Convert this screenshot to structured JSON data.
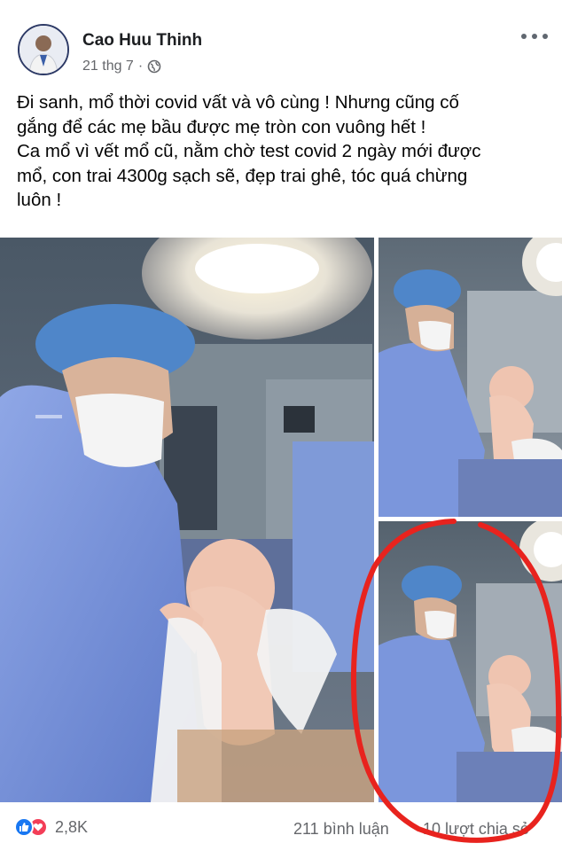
{
  "post": {
    "author": "Cao Huu Thinh",
    "date": "21 thg 7",
    "separator": "·",
    "privacy_icon": "globe-icon",
    "menu_icon": "more-horizontal-icon",
    "text_lines": [
      "Đi sanh, mổ thời covid vất và vô cùng ! Nhưng cũng cố",
      "gắng để các mẹ bầu được mẹ tròn con vuông hết !",
      "Ca mổ vì vết mổ cũ, nằm chờ test covid 2 ngày mới được",
      "mổ, con trai 4300g sạch sẽ, đẹp trai ghê, tóc quá chừng",
      "luôn !"
    ]
  },
  "photos": [
    {
      "description_icon": "operating-room-photo"
    },
    {
      "description_icon": "operating-room-photo"
    },
    {
      "description_icon": "operating-room-photo"
    }
  ],
  "footer": {
    "reaction_icons": [
      "like-icon",
      "love-icon"
    ],
    "reaction_count": "2,8K",
    "comments": "211 bình luận",
    "shares": "10 lượt chia sẻ"
  },
  "colors": {
    "annotation_circle": "#e8231e",
    "like": "#1877f2",
    "love": "#f33e58",
    "meta_text": "#65676b"
  }
}
